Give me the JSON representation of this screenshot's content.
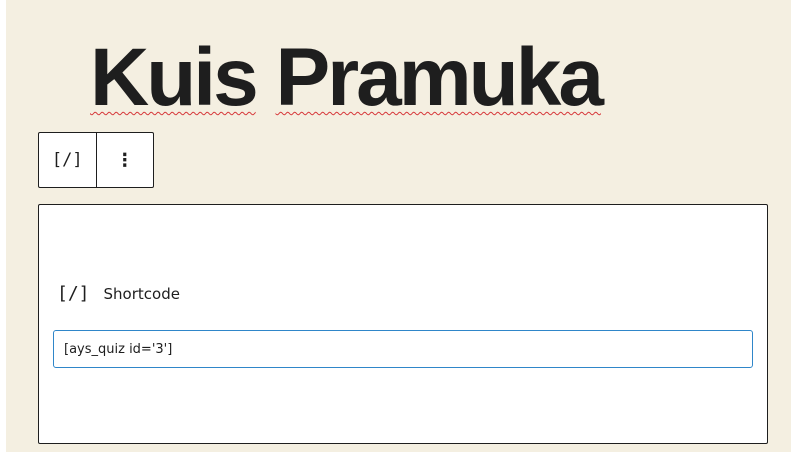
{
  "post": {
    "title_word1": "Kuis",
    "title_word2": "Pramuka"
  },
  "toolbar": {
    "block_icon": "[/]",
    "more_icon": "⋮"
  },
  "shortcode_block": {
    "icon": "[/]",
    "label": "Shortcode",
    "value": "[ays_quiz id='3']"
  },
  "colors": {
    "background": "#f4efe1",
    "title": "#1e1e1e",
    "spellcheck": "#d63638",
    "input_focus": "#2f86c9"
  }
}
